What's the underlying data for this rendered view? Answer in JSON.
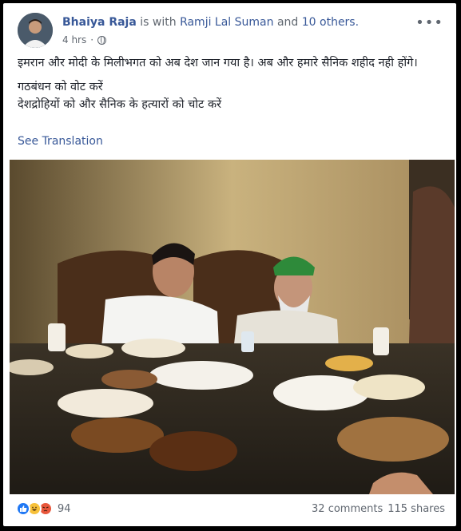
{
  "post": {
    "author": "Bhaiya Raja",
    "with_text": " is with ",
    "tagged": "Ramji Lal Suman",
    "and_text": " and ",
    "others": "10 others.",
    "time": "4 hrs",
    "privacy_icon": "globe-icon",
    "more_icon": "ellipsis-icon",
    "text": {
      "line1": "इमरान और मोदी के मिलीभगत को अब देश जान गया है। अब और हमारे सैनिक शहीद नही होंगे।",
      "line2": "गठबंधन को वोट करें",
      "line3": "देशद्रोहियों को और सैनिक के हत्यारों को चोट करें"
    },
    "see_translation": "See Translation"
  },
  "footer": {
    "reaction_icons": [
      "like-icon",
      "haha-icon",
      "angry-icon"
    ],
    "reaction_count": "94",
    "comments": "32 comments",
    "shares": "115 shares"
  },
  "colors": {
    "link": "#385898",
    "text": "#1d2129",
    "muted": "#606770",
    "like": "#2078f4",
    "haha": "#f7c13a",
    "angry": "#e8563b"
  }
}
